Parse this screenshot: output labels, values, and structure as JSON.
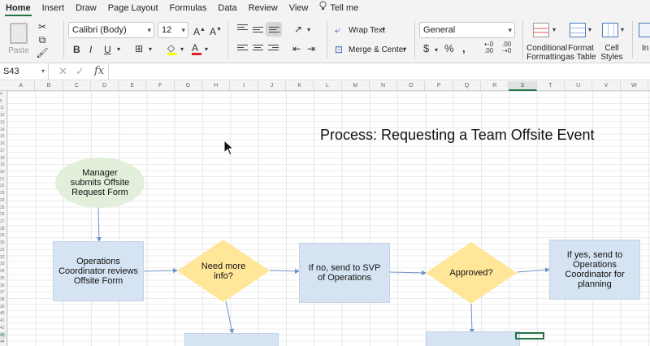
{
  "menu": {
    "tabs": [
      "Home",
      "Insert",
      "Draw",
      "Page Layout",
      "Formulas",
      "Data",
      "Review",
      "View"
    ],
    "tell_me": "Tell me"
  },
  "ribbon": {
    "paste_label": "Paste",
    "font_name": "Calibri (Body)",
    "font_size": "12",
    "wrap_text": "Wrap Text",
    "merge_center": "Merge & Center",
    "number_format": "General",
    "conditional_formatting": [
      "Conditional",
      "Formatting"
    ],
    "format_as_table": [
      "Format",
      "as Table"
    ],
    "cell_styles": [
      "Cell",
      "Styles"
    ],
    "insert_partial": "In"
  },
  "formula_bar": {
    "name_box": "S43",
    "fx": "fx",
    "content": ""
  },
  "sheet": {
    "columns": [
      "A",
      "B",
      "C",
      "D",
      "E",
      "F",
      "G",
      "H",
      "I",
      "J",
      "K",
      "L",
      "M",
      "N",
      "O",
      "P",
      "Q",
      "R",
      "S",
      "T",
      "U",
      "V",
      "W"
    ],
    "selected_column": "S",
    "rows": [
      "4",
      "5",
      "11",
      "12",
      "13",
      "14",
      "15",
      "16",
      "17",
      "18",
      "19",
      "20",
      "21",
      "22",
      "23",
      "24",
      "25",
      "26",
      "27",
      "28",
      "29",
      "30",
      "31",
      "32",
      "33",
      "34",
      "35",
      "36",
      "37",
      "38",
      "39",
      "40",
      "41",
      "42",
      "43",
      "44"
    ],
    "selected_row": "43"
  },
  "flowchart": {
    "title": "Process: Requesting a Team Offsite Event",
    "start": "Manager submits Offsite Request Form",
    "review": "Operations Coordinator reviews Offsite Form",
    "decision_info": "Need more info?",
    "send_svp": "If no, send to SVP of Operations",
    "decision_approved": "Approved?",
    "send_coord": "If yes, send to Operations Coordinator for planning"
  },
  "colors": {
    "accent": "#217346",
    "process_fill": "#d6e3f2",
    "decision_fill": "#ffe699",
    "start_fill": "#e2efda",
    "connector": "#6f93c6"
  }
}
